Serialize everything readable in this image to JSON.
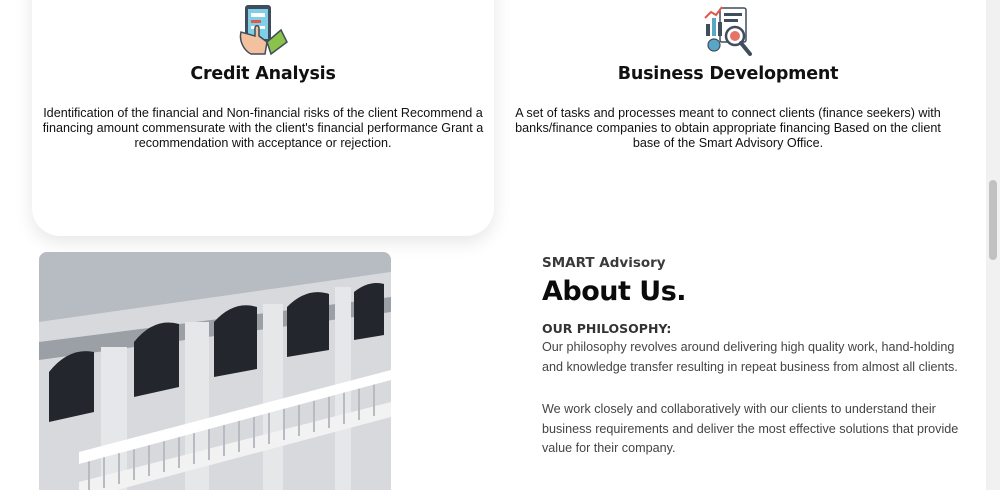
{
  "services": [
    {
      "icon": "tablet-hand-icon",
      "title": "Credit Analysis",
      "description": "Identification of the financial and Non-financial risks of the client Recommend a financing amount commensurate with the client's financial performance Grant a recommendation with acceptance or rejection."
    },
    {
      "icon": "report-magnifier-icon",
      "title": "Business Development",
      "description": "A set of tasks and processes meant to connect clients (finance seekers) with banks/finance companies to obtain appropriate financing Based on the client base of the Smart Advisory Office."
    }
  ],
  "about": {
    "eyebrow": "SMART Advisory",
    "title": "About Us.",
    "philosophy_label": "OUR PHILOSOPHY:",
    "paragraph1": "Our philosophy revolves around delivering high quality work, hand-holding and knowledge transfer resulting in repeat business from almost all clients.",
    "paragraph2": "We work closely and collaboratively with our clients to understand their business requirements and deliver the most effective solutions that provide value for their company."
  },
  "colors": {
    "heading": "#111111",
    "body_text": "#444444",
    "accent_green": "#8bc34a",
    "accent_red": "#e05a4b"
  }
}
